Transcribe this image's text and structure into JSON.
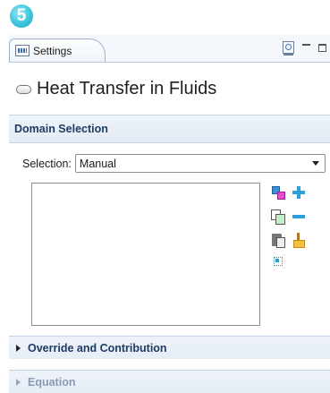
{
  "step_badge": "5",
  "tab": {
    "label": "Settings",
    "icon": "settings-panel-icon",
    "actions": [
      "help-icon",
      "minimize-icon",
      "maximize-icon"
    ]
  },
  "header": {
    "title": "Heat Transfer in Fluids",
    "icon": "physics-interface-icon"
  },
  "domain_selection": {
    "header": "Domain Selection",
    "selection_label": "Selection:",
    "selection_value": "Manual",
    "selected_items": [],
    "tools": [
      "paint-select-icon",
      "add-icon",
      "copy-selection-icon",
      "remove-icon",
      "paste-icon",
      "clear-icon",
      "zoom-selection-icon"
    ]
  },
  "collapsed_sections": [
    {
      "label": "Override and Contribution"
    },
    {
      "label": "Equation"
    }
  ],
  "colors": {
    "accent": "#3dc3dc",
    "section_header_text": "#1e3b64",
    "tool_blue": "#2a9fdc"
  }
}
